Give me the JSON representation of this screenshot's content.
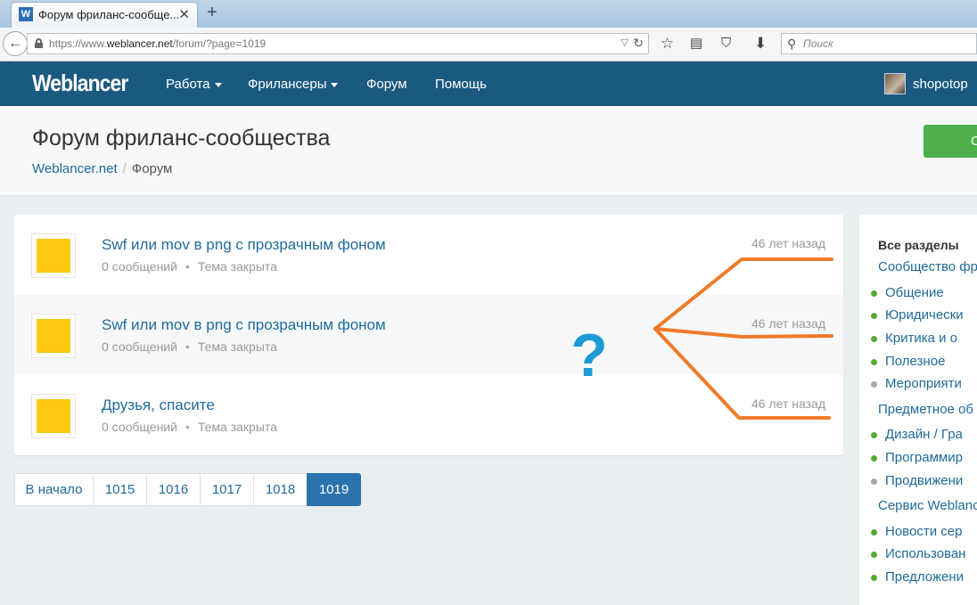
{
  "browser": {
    "tab_title": "Форум фриланс-сообще...",
    "tab_favicon": "W",
    "new_tab": "+",
    "url_prefix": "https://www.",
    "url_domain": "weblancer.net",
    "url_path": "/forum/?page=1019",
    "search_placeholder": "Поиск",
    "icons": [
      "back-arrow-icon",
      "lock-icon",
      "reload-icon",
      "star-icon",
      "reading-list-icon",
      "pocket-icon",
      "download-icon",
      "search-icon"
    ]
  },
  "site": {
    "logo": "Weblancer",
    "menu": [
      "Работа",
      "Фрилансеры",
      "Форум",
      "Помощь"
    ],
    "username": "shopotop",
    "colors": {
      "header": "#1b5a80",
      "link": "#1f6b9a",
      "accent_green": "#4db04a",
      "thumb": "#fdc80f"
    }
  },
  "page": {
    "title": "Форум фриланс-сообщества",
    "breadcrumb": [
      "Weblancer.net",
      "Форум"
    ],
    "action_button_label": "С"
  },
  "topics": [
    {
      "title": "Swf или mov в png с прозрачным фоном",
      "replies": "0 сообщений",
      "status": "Тема закрыта",
      "time": "46 лет назад"
    },
    {
      "title": "Swf или mov в png с прозрачным фоном",
      "replies": "0 сообщений",
      "status": "Тема закрыта",
      "time": "46 лет назад"
    },
    {
      "title": "Друзья, спасите",
      "replies": "0 сообщений",
      "status": "Тема закрыта",
      "time": "46 лет назад"
    }
  ],
  "pagination": [
    "В начало",
    "1015",
    "1016",
    "1017",
    "1018",
    "1019"
  ],
  "pagination_active": "1019",
  "sidebar": {
    "heading": "Все разделы",
    "sections": [
      {
        "title": "Сообщество фри",
        "items": [
          "Общение",
          "Юридически",
          "Критика и о",
          "Полезное",
          "Мероприяти"
        ]
      },
      {
        "title": "Предметное об",
        "items": [
          "Дизайн / Гра",
          "Программир",
          "Продвижени"
        ]
      },
      {
        "title": "Сервис Weblanc",
        "items": [
          "Новости сер",
          "Использован",
          "Предложени"
        ]
      }
    ]
  },
  "annotation": {
    "symbol": "?",
    "color_question": "#1e9bd6",
    "color_lines": "#f07a2a"
  }
}
